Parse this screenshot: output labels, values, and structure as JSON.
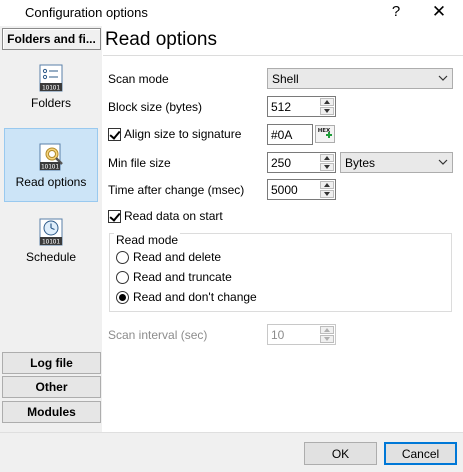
{
  "window": {
    "title": "Configuration options",
    "help_glyph": "?",
    "close_glyph": "✕"
  },
  "sidebar": {
    "top_group": "Folders and fi...",
    "items": [
      {
        "label": "Folders",
        "icon": "folders-icon"
      },
      {
        "label": "Read options",
        "icon": "read-options-icon",
        "selected": true
      },
      {
        "label": "Schedule",
        "icon": "schedule-icon"
      }
    ],
    "bottom_groups": [
      "Log file",
      "Other",
      "Modules"
    ]
  },
  "panel": {
    "heading": "Read options",
    "scan_mode": {
      "label": "Scan mode",
      "value": "Shell"
    },
    "block_size": {
      "label": "Block size (bytes)",
      "value": "512"
    },
    "align_size": {
      "label": "Align size to signature",
      "checked": true,
      "value": "#0A",
      "hex_glyph": "HEX"
    },
    "min_file_size": {
      "label": "Min file size",
      "value": "250",
      "unit": "Bytes"
    },
    "time_after_change": {
      "label": "Time after change (msec)",
      "value": "5000"
    },
    "read_data_on_start": {
      "label": "Read data on start",
      "checked": true
    },
    "read_mode": {
      "legend": "Read mode",
      "options": [
        {
          "label": "Read and delete",
          "selected": false
        },
        {
          "label": "Read and truncate",
          "selected": false
        },
        {
          "label": "Read and don't change",
          "selected": true
        }
      ]
    },
    "scan_interval": {
      "label": "Scan interval (sec)",
      "value": "10",
      "disabled": true
    }
  },
  "footer": {
    "ok_label": "OK",
    "cancel_label": "Cancel"
  },
  "colors": {
    "selection_bg": "#cce4f7",
    "selection_border": "#99c9ef",
    "default_button_border": "#0078d7"
  }
}
